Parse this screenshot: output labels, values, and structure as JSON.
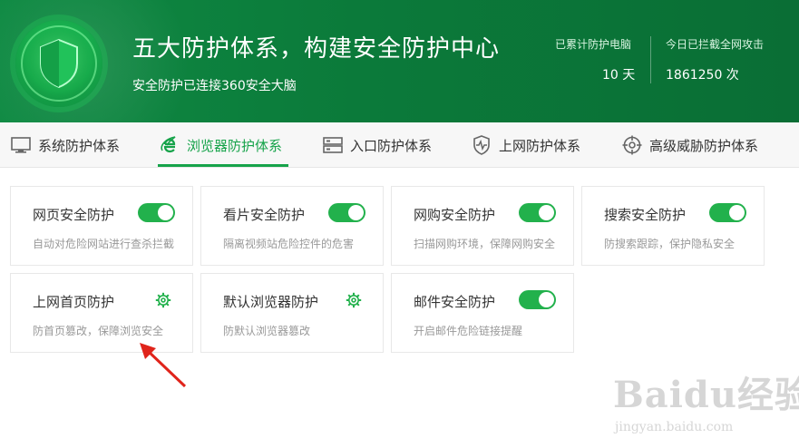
{
  "header": {
    "title": "五大防护体系，构建安全防护中心",
    "subtitle": "安全防护已连接360安全大脑",
    "stats": [
      {
        "label": "已累计防护电脑",
        "value": "10 天"
      },
      {
        "label": "今日已拦截全网攻击",
        "value": "1861250 次"
      }
    ]
  },
  "tabs": [
    {
      "label": "系统防护体系",
      "icon": "monitor-icon"
    },
    {
      "label": "浏览器防护体系",
      "icon": "ie-browser-icon",
      "active": true
    },
    {
      "label": "入口防护体系",
      "icon": "entry-icon"
    },
    {
      "label": "上网防护体系",
      "icon": "shield-pulse-icon"
    },
    {
      "label": "高级威胁防护体系",
      "icon": "crosshair-icon"
    }
  ],
  "cards": [
    {
      "title": "网页安全防护",
      "desc": "自动对危险网站进行查杀拦截",
      "control": "toggle",
      "enabled": true
    },
    {
      "title": "看片安全防护",
      "desc": "隔离视频站危险控件的危害",
      "control": "toggle",
      "enabled": true
    },
    {
      "title": "网购安全防护",
      "desc": "扫描网购环境，保障网购安全",
      "control": "toggle",
      "enabled": true
    },
    {
      "title": "搜索安全防护",
      "desc": "防搜索跟踪，保护隐私安全",
      "control": "toggle",
      "enabled": true
    },
    {
      "title": "上网首页防护",
      "desc": "防首页篡改，保障浏览安全",
      "control": "gear-icon"
    },
    {
      "title": "默认浏览器防护",
      "desc": "防默认浏览器篡改",
      "control": "gear-icon"
    },
    {
      "title": "邮件安全防护",
      "desc": "开启邮件危险链接提醒",
      "control": "toggle",
      "enabled": true
    }
  ],
  "watermark": {
    "logo": "Baidu经验",
    "url": "jingyan.baidu.com"
  },
  "colors": {
    "header_bg": "#0b7a3a",
    "accent": "#16a34a",
    "toggle_on": "#22b14c",
    "annotation_arrow": "#e0241b"
  }
}
